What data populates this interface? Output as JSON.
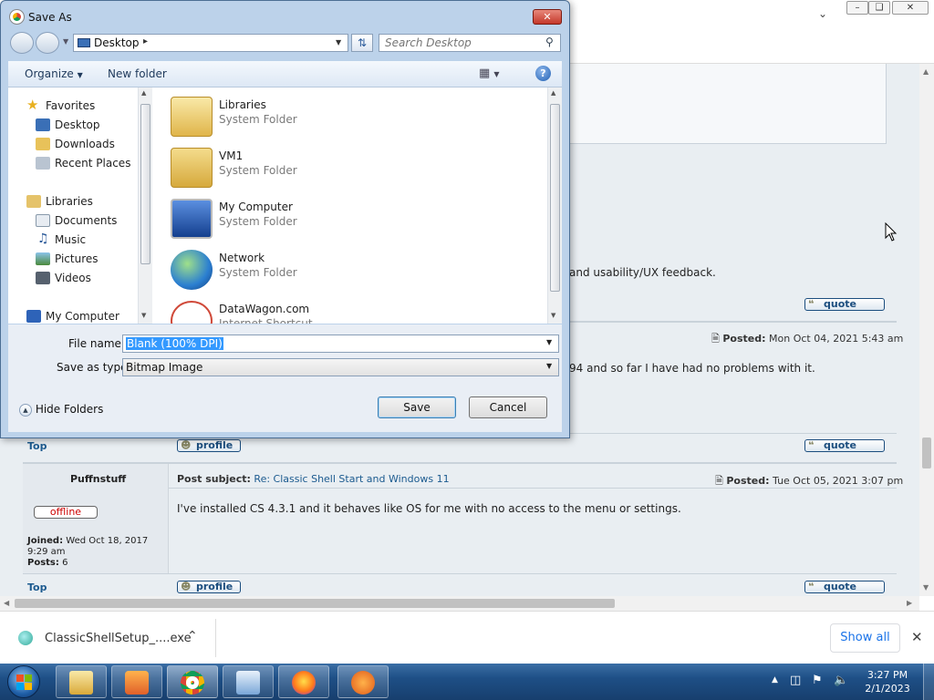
{
  "dialog": {
    "title": "Save As",
    "address": "Desktop",
    "search_placeholder": "Search Desktop",
    "toolbar": {
      "organize": "Organize",
      "new_folder": "New folder"
    },
    "nav": {
      "favorites": "Favorites",
      "desktop": "Desktop",
      "downloads": "Downloads",
      "recent": "Recent Places",
      "libraries": "Libraries",
      "documents": "Documents",
      "music": "Music",
      "pictures": "Pictures",
      "videos": "Videos",
      "my_computer": "My Computer"
    },
    "files": [
      {
        "name": "Libraries",
        "type": "System Folder"
      },
      {
        "name": "VM1",
        "type": "System Folder"
      },
      {
        "name": "My Computer",
        "type": "System Folder"
      },
      {
        "name": "Network",
        "type": "System Folder"
      },
      {
        "name": "DataWagon.com",
        "type": "Internet Shortcut"
      }
    ],
    "file_name_label": "File name:",
    "file_name_value": "Blank (100% DPI)",
    "save_type_label": "Save as type:",
    "save_type_value": "Bitmap Image",
    "hide_folders": "Hide Folders",
    "save_button": "Save",
    "cancel_button": "Cancel"
  },
  "page": {
    "snippet1": "and usability/UX feedback.",
    "posted1_label": "Posted:",
    "posted1_date": "Mon Oct 04, 2021 5:43 am",
    "snippet2": "94 and so far I have had no problems with it.",
    "quote": "quote",
    "profile": "profile",
    "top": "Top",
    "author": "Puffnstuff",
    "status": "offline",
    "joined_label": "Joined:",
    "joined_value": "Wed Oct 18, 2017 9:29 am",
    "posts_label": "Posts:",
    "posts_value": "6",
    "subject_label": "Post subject:",
    "subject_value": "Re: Classic Shell Start and Windows 11",
    "posted2_label": "Posted:",
    "posted2_date": "Tue Oct 05, 2021 3:07 pm",
    "message2": "I've installed CS 4.3.1 and it behaves like OS for me with no access to the menu or settings."
  },
  "shelf": {
    "file": "ClassicShellSetup_....exe",
    "show_all": "Show all"
  },
  "taskbar": {
    "time": "3:27 PM",
    "date": "2/1/2023"
  }
}
